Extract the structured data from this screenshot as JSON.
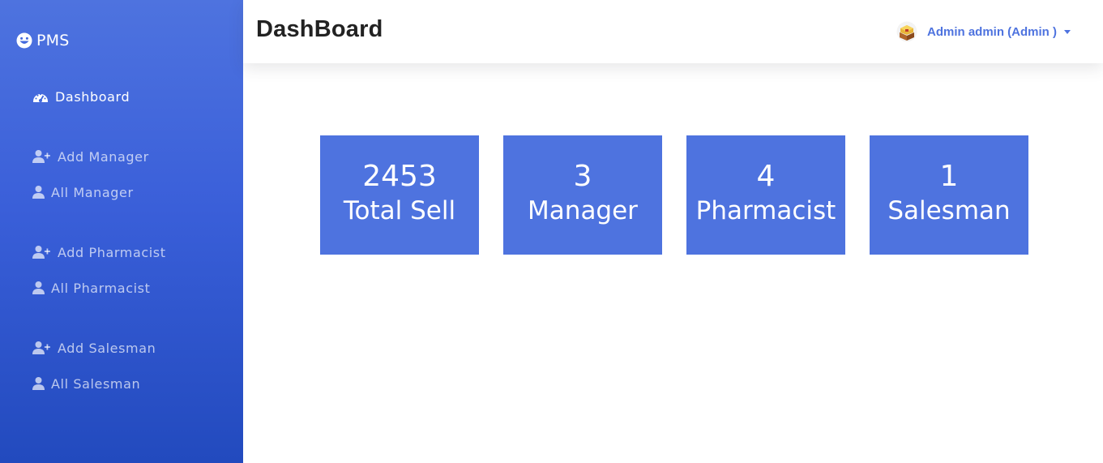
{
  "brand": {
    "name": "PMS",
    "icon": "smile-icon"
  },
  "sidebar": {
    "items": [
      {
        "label": "Dashboard",
        "icon": "tachometer-icon",
        "active": true
      },
      {
        "label": "Add Manager",
        "icon": "user-plus-icon"
      },
      {
        "label": "All Manager",
        "icon": "user-icon"
      },
      {
        "label": "Add Pharmacist",
        "icon": "user-plus-icon"
      },
      {
        "label": "All Pharmacist",
        "icon": "user-icon"
      },
      {
        "label": "Add Salesman",
        "icon": "user-plus-icon"
      },
      {
        "label": "All Salesman",
        "icon": "user-icon"
      }
    ]
  },
  "header": {
    "title": "DashBoard",
    "user": {
      "name": "Admin admin (Admin )",
      "icon": "avatar-icon"
    }
  },
  "cards": [
    {
      "count": "2453",
      "label": "Total Sell"
    },
    {
      "count": "3",
      "label": "Manager"
    },
    {
      "count": "4",
      "label": "Pharmacist"
    },
    {
      "count": "1",
      "label": "Salesman"
    }
  ],
  "colors": {
    "primary": "#4e73df",
    "sidebar_gradient_start": "#4e73df",
    "sidebar_gradient_end": "#224abe",
    "title_text": "#222222"
  }
}
